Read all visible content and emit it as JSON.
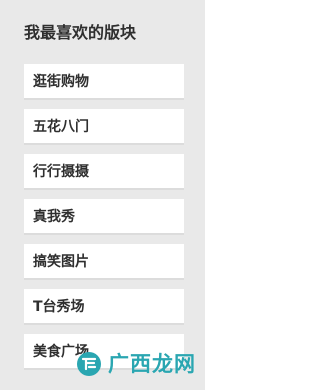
{
  "panel": {
    "title": "我最喜欢的版块",
    "items": [
      {
        "label": "逛街购物"
      },
      {
        "label": "五花八门"
      },
      {
        "label": "行行摄摄"
      },
      {
        "label": "真我秀"
      },
      {
        "label": "搞笑图片"
      },
      {
        "label": "T台秀场"
      },
      {
        "label": "美食广场"
      }
    ]
  },
  "watermark": {
    "text": "广西龙网",
    "color": "#2aa6b1"
  }
}
